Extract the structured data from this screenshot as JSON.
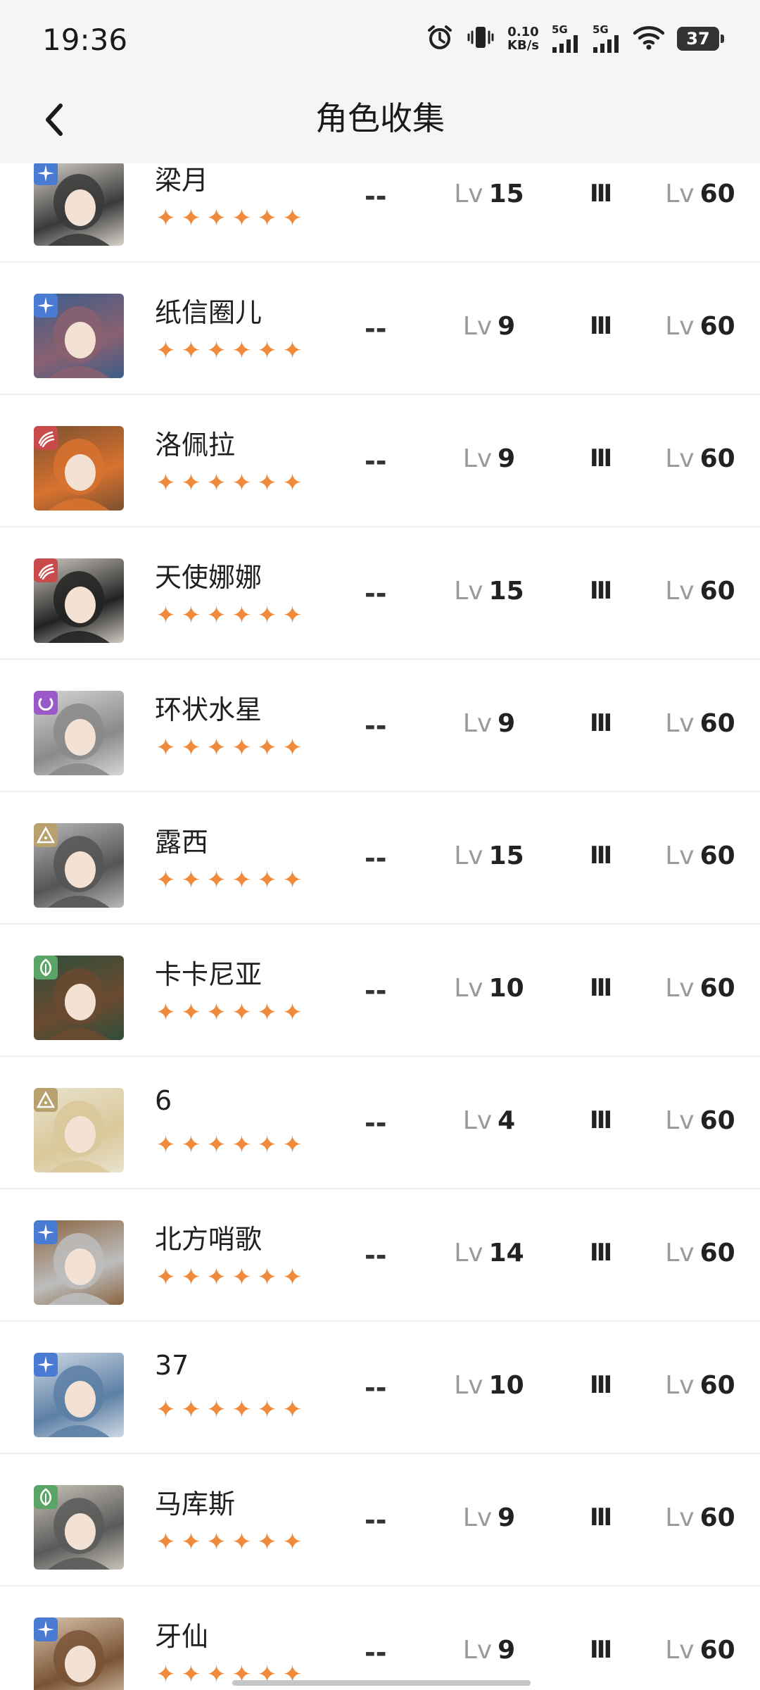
{
  "status": {
    "time": "19:36",
    "net_speed_value": "0.10",
    "net_speed_unit": "KB/s",
    "signal1_label": "5G",
    "signal2_label": "5G",
    "battery": "37"
  },
  "header": {
    "title": "角色收集"
  },
  "columns": {
    "dash_label": "--",
    "lv_prefix": "Lv",
    "rank_label": "Ⅲ"
  },
  "colors": {
    "star": "#f08a3c",
    "elem_blue": "#4a7bd3",
    "elem_red": "#c94a4a",
    "elem_purple": "#9a58c9",
    "elem_beige": "#b8a16e",
    "elem_green": "#5aa467"
  },
  "characters": [
    {
      "name": "梁月",
      "stars": 6,
      "element": "star-burst-icon",
      "element_color": "#4a7bd3",
      "current_level": "15",
      "rank": "Ⅲ",
      "max_level": "60"
    },
    {
      "name": "纸信圈儿",
      "stars": 6,
      "element": "star-burst-icon",
      "element_color": "#4a7bd3",
      "current_level": "9",
      "rank": "Ⅲ",
      "max_level": "60"
    },
    {
      "name": "洛佩拉",
      "stars": 6,
      "element": "wave-icon",
      "element_color": "#c94a4a",
      "current_level": "9",
      "rank": "Ⅲ",
      "max_level": "60"
    },
    {
      "name": "天使娜娜",
      "stars": 6,
      "element": "wave-icon",
      "element_color": "#c94a4a",
      "current_level": "15",
      "rank": "Ⅲ",
      "max_level": "60"
    },
    {
      "name": "环状水星",
      "stars": 6,
      "element": "moon-icon",
      "element_color": "#9a58c9",
      "current_level": "9",
      "rank": "Ⅲ",
      "max_level": "60"
    },
    {
      "name": "露西",
      "stars": 6,
      "element": "pyramid-icon",
      "element_color": "#b8a16e",
      "current_level": "15",
      "rank": "Ⅲ",
      "max_level": "60"
    },
    {
      "name": "卡卡尼亚",
      "stars": 6,
      "element": "leaf-icon",
      "element_color": "#5aa467",
      "current_level": "10",
      "rank": "Ⅲ",
      "max_level": "60"
    },
    {
      "name": "6",
      "stars": 6,
      "element": "pyramid-icon",
      "element_color": "#b8a16e",
      "current_level": "4",
      "rank": "Ⅲ",
      "max_level": "60"
    },
    {
      "name": "北方哨歌",
      "stars": 6,
      "element": "star-burst-icon",
      "element_color": "#4a7bd3",
      "current_level": "14",
      "rank": "Ⅲ",
      "max_level": "60"
    },
    {
      "name": "37",
      "stars": 6,
      "element": "star-burst-icon",
      "element_color": "#4a7bd3",
      "current_level": "10",
      "rank": "Ⅲ",
      "max_level": "60"
    },
    {
      "name": "马库斯",
      "stars": 6,
      "element": "leaf-icon",
      "element_color": "#5aa467",
      "current_level": "9",
      "rank": "Ⅲ",
      "max_level": "60"
    },
    {
      "name": "牙仙",
      "stars": 6,
      "element": "star-burst-icon",
      "element_color": "#4a7bd3",
      "current_level": "9",
      "rank": "Ⅲ",
      "max_level": "60"
    }
  ]
}
